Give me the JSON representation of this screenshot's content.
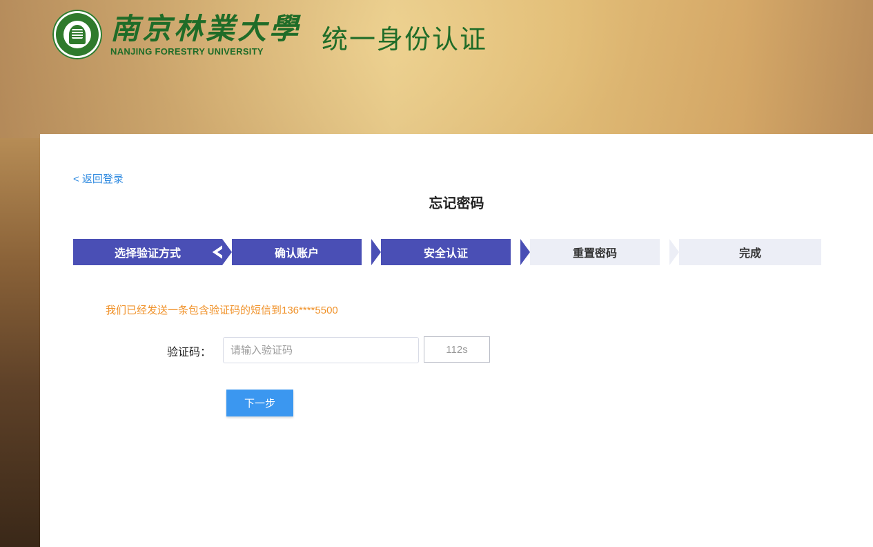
{
  "header": {
    "university_name_cn": "南京林業大學",
    "university_name_en": "NANJING FORESTRY UNIVERSITY",
    "system_title": "统一身份认证",
    "logo_icon": "university-seal-icon"
  },
  "card": {
    "back_label": "< 返回登录",
    "title": "忘记密码"
  },
  "steps": [
    {
      "label": "选择验证方式",
      "state": "done"
    },
    {
      "label": "确认账户",
      "state": "done"
    },
    {
      "label": "安全认证",
      "state": "done"
    },
    {
      "label": "重置密码",
      "state": "todo"
    },
    {
      "label": "完成",
      "state": "todo"
    }
  ],
  "form": {
    "sms_notice": "我们已经发送一条包含验证码的短信到136****5500",
    "code_label": "验证码：",
    "code_placeholder": "请输入验证码",
    "code_value": "",
    "countdown": "112s",
    "next_label": "下一步"
  },
  "colors": {
    "step_done": "#4a4fb5",
    "step_todo": "#eceef6",
    "link": "#2f8ae0",
    "notice": "#f0922a",
    "primary_button": "#3b97f0",
    "logo_green": "#1f6c28"
  }
}
